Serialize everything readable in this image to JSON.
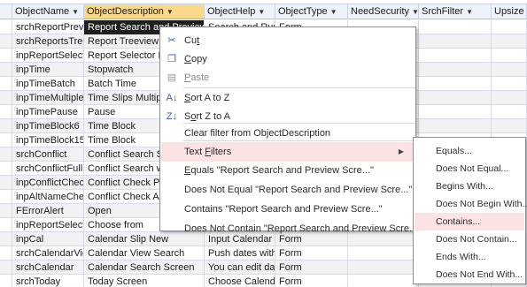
{
  "columns": [
    {
      "label": "",
      "selected": false
    },
    {
      "label": "ObjectName",
      "selected": false
    },
    {
      "label": "ObjectDescription",
      "selected": true
    },
    {
      "label": "ObjectHelp",
      "selected": false
    },
    {
      "label": "ObjectType",
      "selected": false
    },
    {
      "label": "NeedSecurity",
      "selected": false
    },
    {
      "label": "SrchFilter",
      "selected": false
    },
    {
      "label": "Upsize",
      "selected": false
    }
  ],
  "rows": [
    {
      "name": "srchReportPrevi",
      "desc": "Report Search and Preview",
      "help": "Search and Run",
      "type": "Form",
      "highlight": true
    },
    {
      "name": "srchReportsTree",
      "desc": "Report Treeview",
      "help": "",
      "type": ""
    },
    {
      "name": "inpReportSelect",
      "desc": "Report Selector P",
      "help": "",
      "type": ""
    },
    {
      "name": "inpTime",
      "desc": "Stopwatch",
      "help": "",
      "type": ""
    },
    {
      "name": "inpTimeBatch",
      "desc": "Batch Time",
      "help": "",
      "type": ""
    },
    {
      "name": "inpTimeMultiple",
      "desc": "Time Slips Multiple",
      "help": "",
      "type": ""
    },
    {
      "name": "inpTimePause",
      "desc": "Pause",
      "help": "",
      "type": ""
    },
    {
      "name": "inpTimeBlock6",
      "desc": "Time Block",
      "help": "",
      "type": ""
    },
    {
      "name": "inpTimeBlock15",
      "desc": "Time Block",
      "help": "",
      "type": ""
    },
    {
      "name": "srchConflict",
      "desc": "Conflict Search Sc",
      "help": "",
      "type": ""
    },
    {
      "name": "srchConflictFull",
      "desc": "Conflict Search w",
      "help": "",
      "type": ""
    },
    {
      "name": "inpConflictChec",
      "desc": "Conflict Check Pr",
      "help": "",
      "type": ""
    },
    {
      "name": "inpAltNameChe",
      "desc": "Conflict Check Alt",
      "help": "",
      "type": ""
    },
    {
      "name": "FErrorAlert",
      "desc": "Open",
      "help": "",
      "type": ""
    },
    {
      "name": "inpReportSelect",
      "desc": "Choose from",
      "help": "",
      "type": ""
    },
    {
      "name": "inpCal",
      "desc": "Calendar Slip New",
      "help": "Input Calendar",
      "type": "Form"
    },
    {
      "name": "srchCalendarVie",
      "desc": "Calendar View Search",
      "help": "Push dates with",
      "type": "Form"
    },
    {
      "name": "srchCalendar",
      "desc": "Calendar Search Screen",
      "help": "You can edit dat",
      "type": "Form"
    },
    {
      "name": "srchToday",
      "desc": "Today Screen",
      "help": "Choose Calenda",
      "type": "Form"
    }
  ],
  "context_menu": {
    "items": [
      {
        "label": "Cut",
        "u": "t",
        "icon": "scissors-icon",
        "glyph": "✂",
        "disabled": false
      },
      {
        "label": "Copy",
        "u": "C",
        "icon": "copy-icon",
        "glyph": "❐",
        "disabled": false
      },
      {
        "label": "Paste",
        "u": "P",
        "icon": "paste-icon",
        "glyph": "▤",
        "disabled": true
      },
      {
        "label": "Sort A to Z",
        "u": "S",
        "icon": "sort-ascending-icon",
        "glyph": "A↓",
        "disabled": false
      },
      {
        "label": "Sort Z to A",
        "u": "o",
        "icon": "sort-descending-icon",
        "glyph": "Z↓",
        "disabled": false
      },
      {
        "label": "Clear filter from ObjectDescription",
        "u": "",
        "icon": "",
        "glyph": "",
        "disabled": false
      },
      {
        "label": "Text Filters",
        "u": "F",
        "icon": "",
        "glyph": "",
        "disabled": false,
        "hover": true,
        "submenu": true
      },
      {
        "label": "Equals \"Report Search and Preview Scre...\"",
        "u": "E",
        "icon": "",
        "glyph": "",
        "disabled": false
      },
      {
        "label": "Does Not Equal \"Report Search and Preview Scre...\"",
        "u": "",
        "icon": "",
        "glyph": "",
        "disabled": false
      },
      {
        "label": "Contains \"Report Search and Preview Scre...\"",
        "u": "",
        "icon": "",
        "glyph": "",
        "disabled": false
      },
      {
        "label": "Does Not Contain \"Report Search and Preview Scre...\"",
        "u": "",
        "icon": "",
        "glyph": "",
        "disabled": false
      }
    ]
  },
  "text_filters_submenu": {
    "items": [
      {
        "label": "Equals...",
        "hover": false
      },
      {
        "label": "Does Not Equal...",
        "hover": false
      },
      {
        "label": "Begins With...",
        "hover": false
      },
      {
        "label": "Does Not Begin With...",
        "hover": false
      },
      {
        "label": "Contains...",
        "hover": true
      },
      {
        "label": "Does Not Contain...",
        "hover": false
      },
      {
        "label": "Ends With...",
        "hover": false
      },
      {
        "label": "Does Not End With...",
        "hover": false
      }
    ]
  },
  "colors": {
    "selected_header": "#fbd98a",
    "menu_hover": "#fbe3e4",
    "selected_cell": "#1f1f1f"
  }
}
